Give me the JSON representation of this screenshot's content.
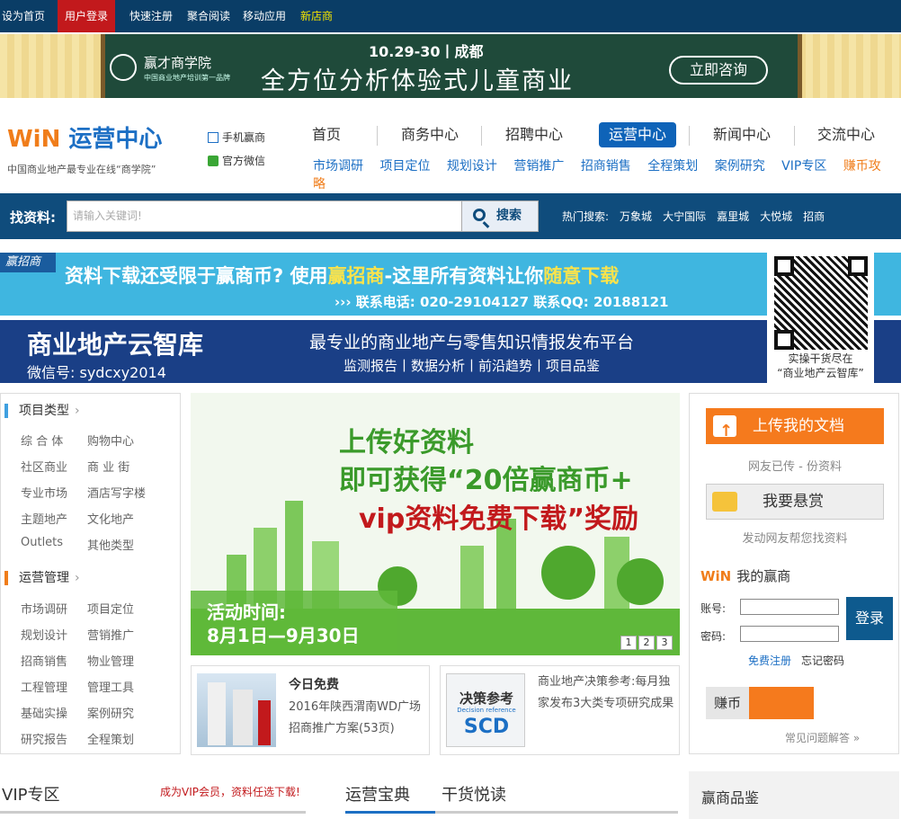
{
  "topbar": {
    "items": [
      "设为首页",
      "用户登录",
      "快速注册",
      "聚合阅读",
      "移动应用",
      "新店商"
    ]
  },
  "banner1": {
    "logo_text": "赢才商学院",
    "logo_sub": "中国商业地产培训第一品牌",
    "date": "10.29-30丨成都",
    "headline": "全方位分析体验式儿童商业",
    "button": "立即咨询"
  },
  "header": {
    "brand_win": "WiN",
    "brand_name": "运营中心",
    "slogan": "中国商业地产最专业在线“商学院”",
    "side_links": [
      "手机赢商",
      "官方微信"
    ],
    "nav": [
      "首页",
      "商务中心",
      "招聘中心",
      "运营中心",
      "新闻中心",
      "交流中心"
    ],
    "nav_active": "运营中心",
    "subnav": [
      "市场调研",
      "项目定位",
      "规划设计",
      "营销推广",
      "招商销售",
      "全程策划",
      "案例研究",
      "VIP专区"
    ],
    "subnav_hot": "赚币攻略"
  },
  "search": {
    "label": "找资料:",
    "placeholder": "请输入关键词!",
    "button": "搜索",
    "hot_label": "热门搜索:",
    "hot": [
      "万象城",
      "大宁国际",
      "嘉里城",
      "大悦城",
      "招商"
    ]
  },
  "ad2": {
    "tag": "赢招商",
    "line1_a": "资料下载还受限于赢商币? 使用",
    "line1_hl": "赢招商",
    "line1_b": "-这里所有资料让你",
    "line1_hl2": "随意下载",
    "line2": "›››  联系电话: 020-29104127  联系QQ: 20188121"
  },
  "ad3": {
    "title": "商业地产云智库",
    "wechat": "微信号: sydcxy2014",
    "slogan": "最专业的商业地产与零售知识情报发布平台",
    "tags": "监测报告丨数据分析丨前沿趋势丨项目品鉴"
  },
  "qr": {
    "caption1": "实操干货尽在",
    "caption2": "“商业地产云智库”"
  },
  "left_menu": {
    "sections": [
      {
        "title": "项目类型",
        "items": [
          "综 合 体",
          "购物中心",
          "社区商业",
          "商 业 街",
          "专业市场",
          "酒店写字楼",
          "主题地产",
          "文化地产",
          "Outlets",
          "其他类型"
        ]
      },
      {
        "title": "运营管理",
        "items": [
          "市场调研",
          "项目定位",
          "规划设计",
          "营销推广",
          "招商销售",
          "物业管理",
          "工程管理",
          "管理工具",
          "基础实操",
          "案例研究",
          "研究报告",
          "全程策划"
        ]
      }
    ]
  },
  "slider": {
    "line1": "上传好资料",
    "line2": "即可获得“20倍赢商币+",
    "line3": "vip资料免费下载”奖励",
    "activity": "活动时间:",
    "date": "8月1日—9月30日",
    "pages": [
      "1",
      "2",
      "3"
    ]
  },
  "cards": [
    {
      "title": "今日免费",
      "text": "2016年陕西渭南WD广场招商推广方案(53页)"
    },
    {
      "img_text": "决策参考",
      "img_sub": "Decision reference",
      "img_logo": "SCD",
      "text": "商业地产决策参考:每月独家发布3大类专项研究成果"
    }
  ],
  "right": {
    "upload": "上传我的文档",
    "upload_note": "网友已传 - 份资料",
    "reward": "我要悬赏",
    "reward_note": "发动网友帮您找资料",
    "my_title": "我的赢商",
    "my_logo": "WiN",
    "account_label": "账号:",
    "password_label": "密码:",
    "login": "登录",
    "register": "免费注册",
    "forgot": "忘记密码",
    "coin": "赚币",
    "faq": "常见问题解答 »"
  },
  "bottom": {
    "vip": "VIP专区",
    "vip_note": "成为VIP会员，资料任选下载!",
    "tab1": "运营宝典",
    "tab2": "干货悦读",
    "pinjian": "赢商品鉴"
  },
  "colors": {
    "topbar": "#0a3d66",
    "accent_blue": "#1c6fc4",
    "accent_orange": "#f07d1a",
    "red": "#c2191c"
  }
}
